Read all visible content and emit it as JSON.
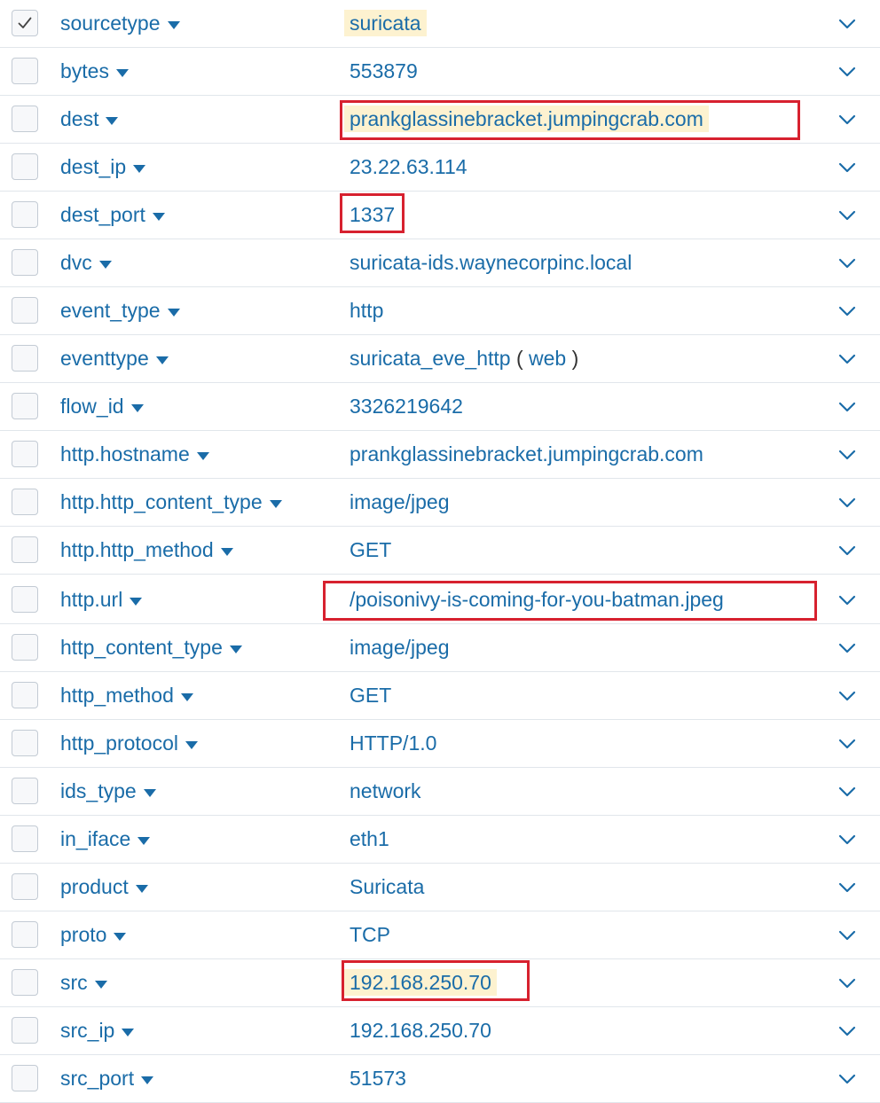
{
  "fields": [
    {
      "name": "sourcetype",
      "value": "suricata",
      "selected": true,
      "highlight": true
    },
    {
      "name": "bytes",
      "value": "553879"
    },
    {
      "name": "dest",
      "value": "prankglassinebracket.jumpingcrab.com",
      "highlight": true,
      "annotated": true
    },
    {
      "name": "dest_ip",
      "value": "23.22.63.114"
    },
    {
      "name": "dest_port",
      "value": "1337",
      "annotated": true
    },
    {
      "name": "dvc",
      "value": "suricata-ids.waynecorpinc.local"
    },
    {
      "name": "event_type",
      "value": "http"
    },
    {
      "name": "eventtype",
      "value": "suricata_eve_http",
      "tag": "web"
    },
    {
      "name": "flow_id",
      "value": "3326219642"
    },
    {
      "name": "http.hostname",
      "value": "prankglassinebracket.jumpingcrab.com"
    },
    {
      "name": "http.http_content_type",
      "value": "image/jpeg"
    },
    {
      "name": "http.http_method",
      "value": "GET"
    },
    {
      "name": "http.url",
      "value": "/poisonivy-is-coming-for-you-batman.jpeg",
      "annotated": true
    },
    {
      "name": "http_content_type",
      "value": "image/jpeg"
    },
    {
      "name": "http_method",
      "value": "GET"
    },
    {
      "name": "http_protocol",
      "value": "HTTP/1.0"
    },
    {
      "name": "ids_type",
      "value": "network"
    },
    {
      "name": "in_iface",
      "value": "eth1"
    },
    {
      "name": "product",
      "value": "Suricata"
    },
    {
      "name": "proto",
      "value": "TCP"
    },
    {
      "name": "src",
      "value": "192.168.250.70",
      "highlight": true,
      "annotated": true
    },
    {
      "name": "src_ip",
      "value": "192.168.250.70"
    },
    {
      "name": "src_port",
      "value": "51573"
    }
  ],
  "colors": {
    "link": "#1a6ca8",
    "highlight_bg": "#fdf2d0",
    "annotation": "#d7212f",
    "row_divider": "#e1e6eb",
    "checkbox_border": "#c3cbd4"
  },
  "icons": {
    "field_menu": "caret-down-icon",
    "row_toggle": "chevron-down-icon",
    "selected": "checkmark-icon"
  }
}
